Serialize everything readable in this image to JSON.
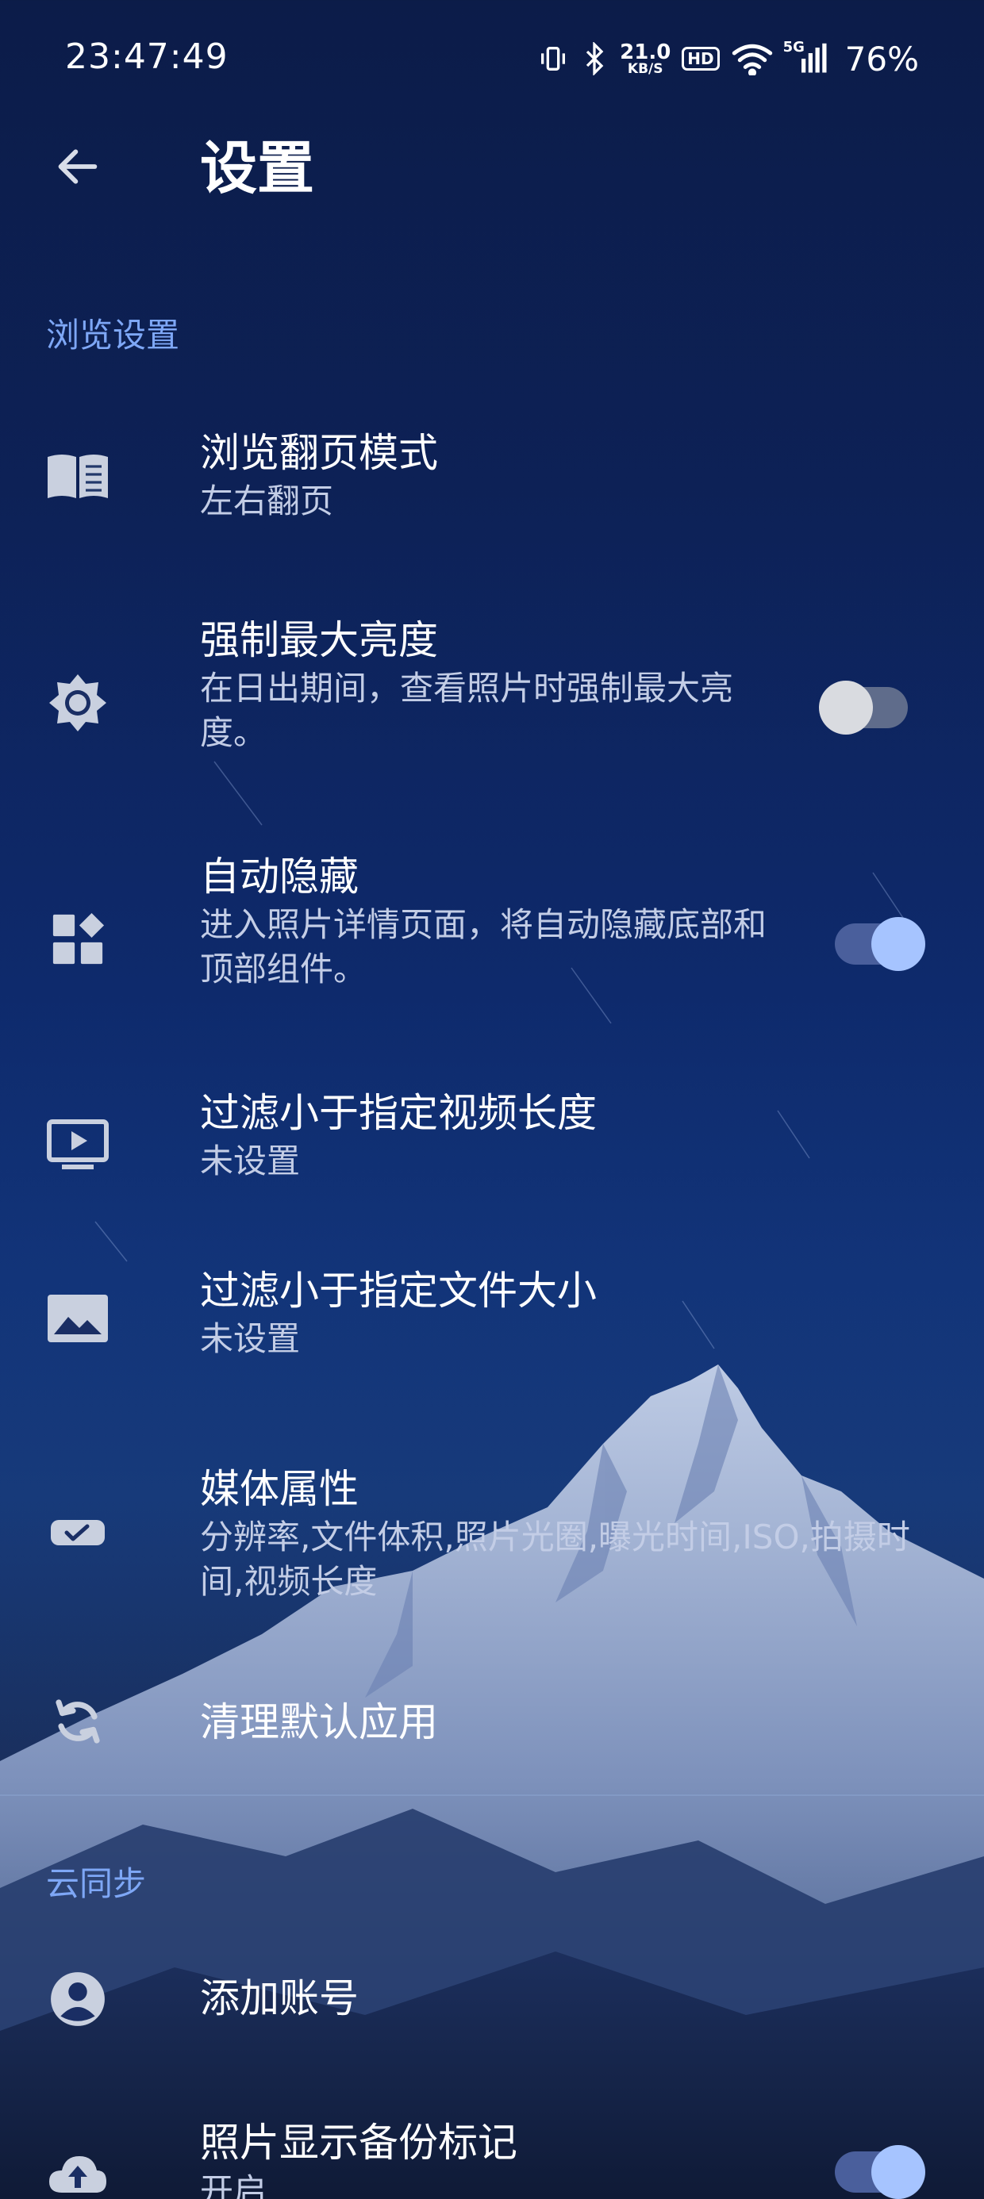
{
  "status_bar": {
    "time": "23:47:49",
    "net_speed_value": "21.0",
    "net_speed_unit": "KB/S",
    "hd_label": "HD",
    "signal_label": "5G",
    "battery": "76%"
  },
  "header": {
    "title": "设置"
  },
  "sections": [
    {
      "title": "浏览设置",
      "items": [
        {
          "icon": "book-icon",
          "title": "浏览翻页模式",
          "subtitle": "左右翻页"
        },
        {
          "icon": "brightness-icon",
          "title": "强制最大亮度",
          "subtitle": "在日出期间，查看照片时强制最大亮度。",
          "toggle": "off"
        },
        {
          "icon": "widgets-icon",
          "title": "自动隐藏",
          "subtitle": "进入照片详情页面，将自动隐藏底部和顶部组件。",
          "toggle": "on"
        },
        {
          "icon": "video-icon",
          "title": "过滤小于指定视频长度",
          "subtitle": "未设置"
        },
        {
          "icon": "image-icon",
          "title": "过滤小于指定文件大小",
          "subtitle": "未设置"
        },
        {
          "icon": "label-check-icon",
          "title": "媒体属性",
          "subtitle": "分辨率,文件体积,照片光圈,曝光时间,ISO,拍摄时间,视频长度"
        },
        {
          "icon": "sync-icon",
          "title": "清理默认应用"
        }
      ]
    },
    {
      "title": "云同步",
      "items": [
        {
          "icon": "account-icon",
          "title": "添加账号"
        },
        {
          "icon": "cloud-upload-icon",
          "title": "照片显示备份标记",
          "subtitle": "开启",
          "toggle": "on"
        }
      ]
    }
  ],
  "colors": {
    "accent": "#7ea7f6",
    "switch_on_knob": "#a6c4ff",
    "switch_off_knob": "#d9dbe0",
    "background_top": "#0c1c49"
  }
}
